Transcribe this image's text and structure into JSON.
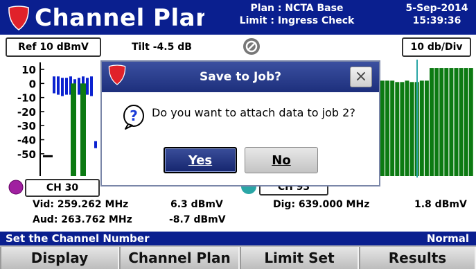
{
  "header": {
    "title": "Channel Plan Scan",
    "plan_line": "Plan : NCTA Base",
    "limit_line": "Limit : Ingress Check",
    "date": "5-Sep-2014",
    "time": "15:39:36"
  },
  "toolbar": {
    "ref_label": "Ref 10 dBmV",
    "tilt_label": "Tilt -4.5 dB",
    "scale_label": "10 db/Div"
  },
  "chart_data": {
    "type": "bar",
    "y_tick_labels": [
      "10",
      "0",
      "-10",
      "-20",
      "-30",
      "-40",
      "-50"
    ],
    "ylim": [
      -57,
      13
    ],
    "left_bars_blue": [
      {
        "x": 1,
        "top": 5,
        "bottom": -7
      },
      {
        "x": 2,
        "top": 5,
        "bottom": -8
      },
      {
        "x": 3,
        "top": 4,
        "bottom": -9
      },
      {
        "x": 4,
        "top": 4,
        "bottom": -8
      },
      {
        "x": 5,
        "top": 5,
        "bottom": -8
      },
      {
        "x": 6,
        "top": 3,
        "bottom": -9
      },
      {
        "x": 7,
        "top": 4,
        "bottom": -8
      },
      {
        "x": 8,
        "top": 5,
        "bottom": -7
      },
      {
        "x": 9,
        "top": 4,
        "bottom": -8
      },
      {
        "x": 10,
        "top": 5,
        "bottom": -9
      },
      {
        "x": 11,
        "top": -41,
        "bottom": -46
      }
    ],
    "left_bars_green": [
      {
        "x": 1,
        "top": 0
      },
      {
        "x": 2,
        "top": 0
      }
    ],
    "right_bars_green": [
      2,
      2,
      2,
      1,
      1,
      2,
      1,
      1,
      2,
      2,
      11,
      11,
      11,
      11,
      11,
      11,
      11,
      11,
      11
    ]
  },
  "marker": {
    "left_channel": "CH 30",
    "right_channel": "CH 93",
    "vid_label": "Vid: 259.262 MHz",
    "vid_level": "6.3 dBmV",
    "aud_label": "Aud: 263.762 MHz",
    "aud_level": "-8.7 dBmV",
    "dig_label": "Dig: 639.000 MHz",
    "dig_level": "1.8 dBmV"
  },
  "status": {
    "left": "Set the Channel Number",
    "right": "Normal"
  },
  "softkeys": [
    "Display",
    "Channel Plan",
    "Limit Set",
    "Results"
  ],
  "dialog": {
    "title": "Save to Job?",
    "message": "Do you want to attach data to job 2?",
    "yes_label": "Yes",
    "no_label": "No",
    "close_glyph": "×"
  },
  "colors": {
    "title_bar": "#0a1f8f",
    "bar_blue": "#0b22d0",
    "bar_green": "#0c7a12",
    "marker_line": "#2aa6a6",
    "brand_red": "#e0222a"
  }
}
